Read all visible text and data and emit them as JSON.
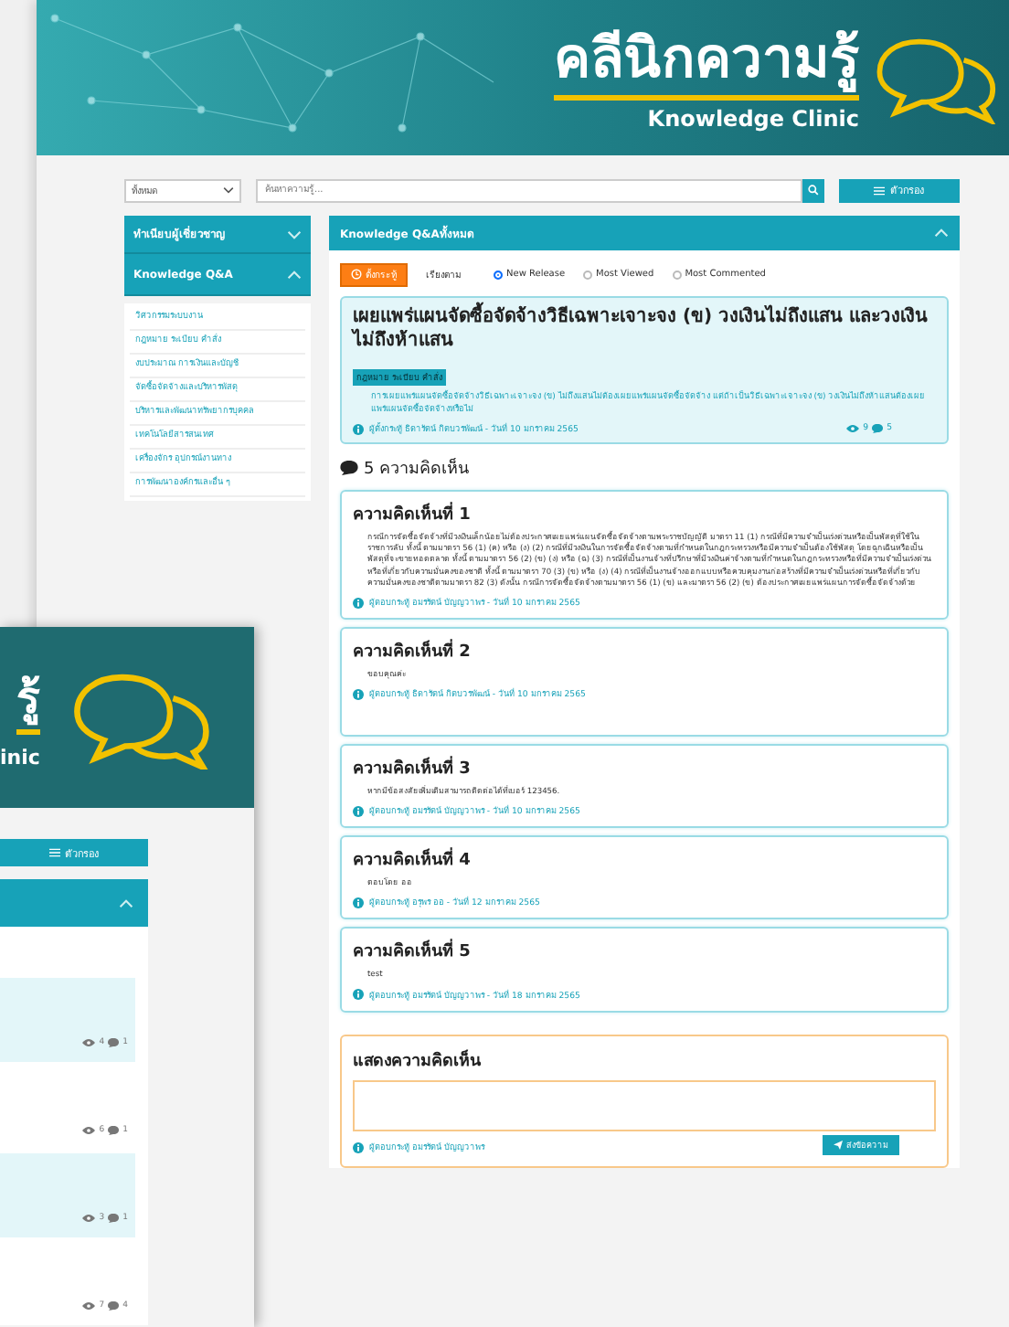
{
  "header": {
    "title": "คลีนิกความรู้",
    "subtitle": "Knowledge Clinic"
  },
  "toolbar": {
    "category": "ทั้งหมด",
    "search": {
      "placeholder": "ค้นหาความรู้..."
    },
    "filter_button": "ตัวกรอง"
  },
  "sidebar": {
    "sections": [
      {
        "title": "ทำเนียบผู้เชี่ยวชาญ",
        "expanded": false
      },
      {
        "title": "Knowledge Q&A",
        "expanded": true,
        "items": [
          "วิศวกรรมระบบงาน",
          "กฎหมาย ระเบียบ คำสั่ง",
          "งบประมาณ การเงินและบัญชี",
          "จัดซื้อจัดจ้างและบริหารพัสดุ",
          "บริหารและพัฒนาทรัพยากรบุคคล",
          "เทคโนโลยีสารสนเทศ",
          "เครื่องจักร อุปกรณ์งานทาง",
          "การพัฒนาองค์กรและอื่น ๆ"
        ]
      }
    ]
  },
  "panel": {
    "title": "Knowledge Q&Aทั้งหมด",
    "expanded": true,
    "new_topic_button": "ตั้งกระทู้",
    "sort_label": "เรียงตาม",
    "sort_options": [
      {
        "label": "New Release",
        "selected": true
      },
      {
        "label": "Most Viewed",
        "selected": false
      },
      {
        "label": "Most Commented",
        "selected": false
      }
    ],
    "question": {
      "title": "เผยแพร่แผนจัดซื้อจัดจ้างวิธีเฉพาะเจาะจง (ข) วงเงินไม่ถึงแสน และวงเงินไม่ถึงห้าแสน",
      "tag": "กฎหมาย ระเบียบ คำสั่ง",
      "body": "การเผยแพร่แผนจัดซื้อจัดจ้างวิธีเฉพาะเจาะจง (ข) ไม่ถึงแสนไม่ต้องเผยแพร่แผนจัดซื้อจัดจ้าง แต่ถ้าเป็นวิธีเฉพาะเจาะจง (ข) วงเงินไม่ถึงห้าแสนต้องเผยแพร่แผนจัดซื้อจัดจ้างหรือไม่",
      "author": "ผู้ตั้งกระทู้ ธิดารัตน์ กิตบวรพัฒน์ - วันที่ 10 มกราคม 2565",
      "views": "9",
      "comments": "5"
    },
    "comments_heading": "5 ความคิดเห็น",
    "comments": [
      {
        "title": "ความคิดเห็นที่ 1",
        "body": "กรณีการจัดซื้อจัดจ้างที่มีวงเงินเล็กน้อยไม่ต้องประกาศเผยแพร่แผนจัดซื้อจัดจ้างตามพระราชบัญญัติ มาตรา 11 (1) กรณีที่มีความจำเป็นเร่งด่วนหรือเป็นพัสดุที่ใช้ในราชการลับ ทั้งนี้ ตามมาตรา 56 (1) (ค) หรือ (ง) (2) กรณีที่มีวงเงินในการจัดซื้อจัดจ้างตามที่กำหนดในกฎกระทรวงหรือมีความจำเป็นต้องใช้พัสดุ โดยฉุกเฉินหรือเป็นพัสดุที่จะขายทอดตลาด ทั้งนี้ ตามมาตรา 56 (2) (ข) (ง) หรือ (ฉ) (3) กรณีที่เป็นงานจ้างที่ปรึกษาที่มีวงเงินค่าจ้างตามที่กำหนดในกฎกระทรวงหรือที่มีความจำเป็นเร่งด่วนหรือที่เกี่ยวกับความมั่นคงของชาติ ทั้งนี้ ตามมาตรา 70 (3) (ข) หรือ (ง) (4) กรณีที่เป็นงานจ้างออกแบบหรือควบคุมงานก่อสร้างที่มีความจำเป็นเร่งด่วนหรือที่เกี่ยวกับความมั่นคงของชาติตามมาตรา 82 (3) ดังนั้น กรณีการจัดซื้อจัดจ้างตามมาตรา 56 (1) (ข) และมาตรา 56 (2) (ข) ต้องประกาศเผยแพร่แผนการจัดซื้อจัดจ้างด้วย",
        "author": "ผู้ตอบกระทู้ อมรรัตน์ บัญญวาพร - วันที่ 10 มกราคม 2565"
      },
      {
        "title": "ความคิดเห็นที่ 2",
        "body": "ขอบคุณค่ะ",
        "author": "ผู้ตอบกระทู้ ธิดารัตน์ กิตบวรพัฒน์ - วันที่ 10 มกราคม 2565"
      },
      {
        "title": "ความคิดเห็นที่ 3",
        "body": "หากมีข้อสงสัยเพิ่มเติมสามารถติดต่อได้ที่เบอร์ 123456.",
        "author": "ผู้ตอบกระทู้ อมรรัตน์ บัญญวาพร - วันที่ 10 มกราคม 2565"
      },
      {
        "title": "ความคิดเห็นที่ 4",
        "body": "ตอบโดย ออ",
        "author": "ผู้ตอบกระทู้ อรุพร ออ - วันที่ 12 มกราคม 2565"
      },
      {
        "title": "ความคิดเห็นที่ 5",
        "body": "test",
        "author": "ผู้ตอบกระทู้ อมรรัตน์ บัญญวาพร - วันที่ 18 มกราคม 2565"
      }
    ],
    "reply_form": {
      "title": "แสดงความคิดเห็น",
      "author": "ผู้ตอบกระทู้ อมรรัตน์ บัญญวาพร",
      "send_button": "ส่งข้อความ"
    }
  },
  "front_window": {
    "header": {
      "title": "รู้",
      "subtitle": "inic"
    },
    "filter_button": "ตัวกรอง",
    "panel": {
      "expanded": true
    },
    "rows": [
      {
        "views": "4",
        "comments": "1",
        "highlighted": true
      },
      {
        "views": "6",
        "comments": "1",
        "highlighted": false
      },
      {
        "views": "3",
        "comments": "1",
        "highlighted": true
      },
      {
        "views": "7",
        "comments": "4",
        "highlighted": false
      }
    ]
  }
}
